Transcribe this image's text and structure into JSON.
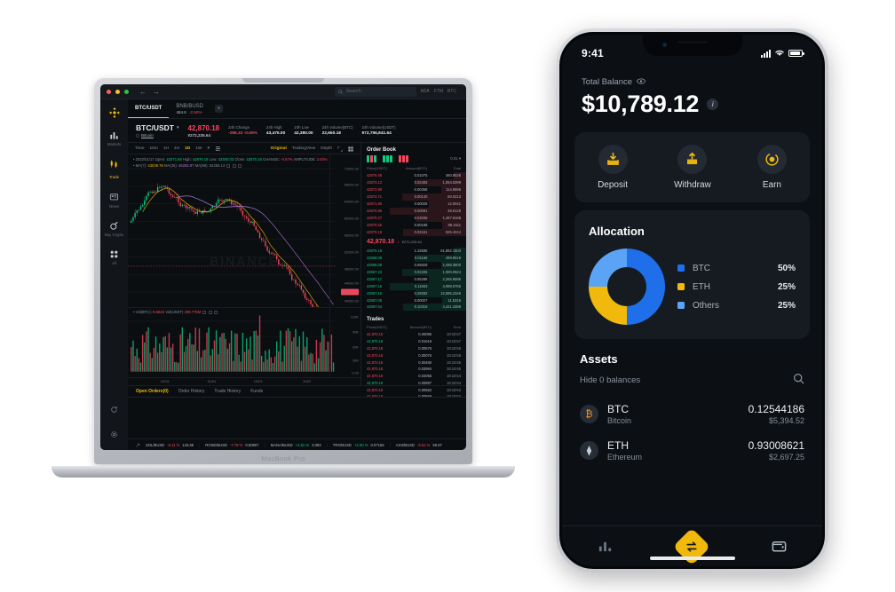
{
  "laptop": {
    "model_label": "MacBook Pro",
    "titlebar": {
      "back_icon": "arrow-left-icon",
      "forward_icon": "arrow-right-icon",
      "search_placeholder": "Search",
      "tags": [
        "ADA",
        "FTM",
        "BTC"
      ]
    },
    "sidebar": {
      "logo": "binance-logo-icon",
      "items": [
        {
          "label": "Markets",
          "icon": "bar-chart-icon",
          "active": false
        },
        {
          "label": "Trade",
          "icon": "candles-icon",
          "active": true
        },
        {
          "label": "News",
          "icon": "news-icon",
          "active": false
        },
        {
          "label": "Buy Crypto",
          "icon": "coin-icon",
          "active": false
        },
        {
          "label": "All",
          "icon": "grid-icon",
          "active": false
        }
      ],
      "bottom": [
        {
          "label": "refresh-icon"
        },
        {
          "label": "settings-icon"
        }
      ]
    },
    "pair_tabs": [
      {
        "label": "BTC/USDT",
        "active": true,
        "price": "",
        "change": ""
      },
      {
        "label": "BNB/BUSD",
        "active": false,
        "price": "484.6",
        "change": "-2.50%"
      }
    ],
    "add_tab_label": "+",
    "ticker": {
      "pair": "BTC/USDT",
      "chevron": "▾",
      "sub_link": "Bitcoin",
      "last_price": "42,870.18",
      "last_price_fiat": "¥272,235.64",
      "stats": [
        {
          "key": "24h Change",
          "value": "-286.32 -0.65%",
          "down": true
        },
        {
          "key": "24h High",
          "value": "43,475.00",
          "down": false
        },
        {
          "key": "24h Low",
          "value": "42,380.00",
          "down": false
        },
        {
          "key": "24h Volume(BTC)",
          "value": "22,650.18",
          "down": false
        },
        {
          "key": "24h Volume(USDT)",
          "value": "972,756,841.64",
          "down": false
        }
      ]
    },
    "timeframes": {
      "label": "Time",
      "items": [
        {
          "label": "15m",
          "active": false
        },
        {
          "label": "1H",
          "active": false
        },
        {
          "label": "4H",
          "active": false
        },
        {
          "label": "1D",
          "active": true
        },
        {
          "label": "1W",
          "active": false
        }
      ],
      "chevron": "▾",
      "settings_icon": "chart-settings-icon",
      "views": [
        {
          "label": "Original",
          "active": true
        },
        {
          "label": "TradingView",
          "active": false
        },
        {
          "label": "Depth",
          "active": false
        }
      ],
      "expand_icon": "expand-icon",
      "layout_icon": "layout-grid-icon"
    },
    "chart": {
      "watermark": "BINANCE",
      "ohlc_line": {
        "date": "2022/01/17",
        "open_label": "Open:",
        "open": "42071.66",
        "high_label": "High:",
        "high": "42876.18",
        "low_label": "Low:",
        "low": "42300.03",
        "close_label": "Close:",
        "close": "42870.18",
        "change_label": "CHANGE:",
        "change": "-0.67%",
        "amp_label": "AMPLITUDE:",
        "amplitude": "2.83%"
      },
      "ma_line": {
        "ma7_label": "MA(7):",
        "ma7": "43039.76",
        "ma25_label": "MA(25):",
        "ma25": "46282.97",
        "ma99_label": "MA(99):",
        "ma99": "54256.13"
      },
      "volume_line": {
        "vol_btc_label": "Vol(BTC):",
        "vol_btc": "9.584K",
        "vol_usdt_label": "Vol(USDT)",
        "vol_usdt": "408.776M"
      },
      "y_ticks": [
        "72000.00",
        "68000.00",
        "64000.00",
        "60000.00",
        "56000.00",
        "52000.00",
        "48000.00",
        "44000.00",
        "40000.00"
      ],
      "y_marker": "42870.18",
      "vol_y_ticks": [
        "120K",
        "90K",
        "60K",
        "30K",
        "0.00"
      ],
      "x_ticks": [
        "10/01",
        "11/01",
        "12/01",
        "2022"
      ]
    },
    "orderbook": {
      "title": "Order Book",
      "precision": "0.01",
      "headers": [
        "Price(USDT)",
        "Amount(BTC)",
        "Total"
      ],
      "asks": [
        {
          "price": "42876.48",
          "amount": "0.01075",
          "total": "460.9528"
        },
        {
          "price": "42873.13",
          "amount": "0.02483",
          "total": "1,064.5399"
        },
        {
          "price": "42872.99",
          "amount": "0.00358",
          "total": "114.8996"
        },
        {
          "price": "42872.71",
          "amount": "0.00140",
          "total": "60.0213"
        },
        {
          "price": "42871.86",
          "amount": "0.00028",
          "total": "12.0041"
        },
        {
          "price": "42870.96",
          "amount": "0.00091",
          "total": "39.0125"
        },
        {
          "price": "42870.27",
          "amount": "0.03036",
          "total": "1,287.9188"
        },
        {
          "price": "42870.26",
          "amount": "0.00188",
          "total": "89.1611"
        },
        {
          "price": "42870.19",
          "amount": "0.02161",
          "total": "926.4244"
        }
      ],
      "mid_price": "42,870.18",
      "mid_arrow": "↓",
      "mid_fiat": "¥272,235.64",
      "bids": [
        {
          "price": "42870.18",
          "amount": "1.42585",
          "total": "61,892.1503"
        },
        {
          "price": "42868.09",
          "amount": "0.01166",
          "total": "499.8619"
        },
        {
          "price": "42868.08",
          "amount": "0.05829",
          "total": "2,498.3800"
        },
        {
          "price": "42867.23",
          "amount": "0.02335",
          "total": "1,000.0924"
        },
        {
          "price": "42867.17",
          "amount": "0.05286",
          "total": "2,265.9586"
        },
        {
          "price": "42867.16",
          "amount": "0.11663",
          "total": "4,999.5765"
        },
        {
          "price": "42867.15",
          "amount": "0.29282",
          "total": "12,595.2346"
        },
        {
          "price": "42867.05",
          "amount": "0.00027",
          "total": "11.5316"
        },
        {
          "price": "42867.04",
          "amount": "0.10316",
          "total": "4,421.3388"
        }
      ]
    },
    "trades": {
      "title": "Trades",
      "headers": [
        "Price(USDT)",
        "Amount(BTC)",
        "Time"
      ],
      "rows": [
        {
          "price": "42,870.18",
          "amount": "0.00095",
          "time": "18:10:57",
          "up": false
        },
        {
          "price": "42,870.19",
          "amount": "0.01619",
          "time": "18:10:57",
          "up": true
        },
        {
          "price": "42,870.18",
          "amount": "0.00676",
          "time": "18:10:56",
          "up": false
        },
        {
          "price": "42,870.18",
          "amount": "0.00076",
          "time": "18:10:56",
          "up": false
        },
        {
          "price": "42,870.18",
          "amount": "0.00480",
          "time": "18:10:55",
          "up": false
        },
        {
          "price": "42,870.18",
          "amount": "0.03994",
          "time": "18:10:55",
          "up": false
        },
        {
          "price": "42,870.18",
          "amount": "0.04055",
          "time": "18:10:54",
          "up": false
        },
        {
          "price": "42,870.19",
          "amount": "0.00897",
          "time": "18:10:54",
          "up": true
        },
        {
          "price": "42,870.18",
          "amount": "0.00562",
          "time": "18:10:53",
          "up": false
        },
        {
          "price": "42,870.18",
          "amount": "0.00569",
          "time": "18:10:52",
          "up": false
        }
      ]
    },
    "order_tabs": [
      {
        "label": "Open Orders(0)",
        "active": true
      },
      {
        "label": "Order History",
        "active": false
      },
      {
        "label": "Trade History",
        "active": false
      },
      {
        "label": "Funds",
        "active": false
      }
    ],
    "bottom_ticker": [
      {
        "symbol": "SOL/BUSD",
        "change": "-6.11 %",
        "price": "143.66",
        "down": true
      },
      {
        "symbol": "ROSE/BUSD",
        "change": "-7.79 %",
        "price": "0.50807",
        "down": true
      },
      {
        "symbol": "MANA/BUSD",
        "change": "+2.51 %",
        "price": "3.083",
        "down": false
      },
      {
        "symbol": "TRX/BUSD",
        "change": "+2.00 %",
        "price": "0.07156",
        "down": false
      },
      {
        "symbol": "AXS/BUSD",
        "change": "-6.51 %",
        "price": "59.67",
        "down": true
      }
    ]
  },
  "phone": {
    "status": {
      "time": "9:41",
      "signal_icon": "cellular-bars-icon",
      "wifi_icon": "wifi-icon",
      "battery_icon": "battery-icon"
    },
    "balance": {
      "label": "Total Balance",
      "eye_icon": "eye-icon",
      "amount": "$10,789.12",
      "info_icon": "info-icon",
      "info_glyph": "i"
    },
    "actions": [
      {
        "label": "Deposit",
        "icon": "deposit-icon"
      },
      {
        "label": "Withdraw",
        "icon": "withdraw-icon"
      },
      {
        "label": "Earn",
        "icon": "earn-icon"
      }
    ],
    "allocation": {
      "title": "Allocation"
    },
    "assets": {
      "title": "Assets",
      "hide_label": "Hide 0 balances",
      "search_icon": "search-icon",
      "rows": [
        {
          "symbol": "BTC",
          "name": "Bitcoin",
          "glyph": "₿",
          "color": "#f7931a",
          "qty": "0.12544186",
          "usd": "$5,394.52"
        },
        {
          "symbol": "ETH",
          "name": "Ethereum",
          "glyph": "⧫",
          "color": "#c9cdd4",
          "qty": "0.93008621",
          "usd": "$2,697.25"
        }
      ]
    },
    "tabbar": [
      {
        "icon": "chart-icon",
        "active": false
      },
      {
        "icon": "swap-icon",
        "active": true
      },
      {
        "icon": "wallet-icon",
        "active": false
      }
    ]
  },
  "chart_data": {
    "type": "pie",
    "title": "Allocation",
    "labels": [
      "BTC",
      "ETH",
      "Others"
    ],
    "values": [
      50,
      25,
      25
    ],
    "display_values": [
      "50%",
      "25%",
      "25%"
    ],
    "colors": [
      "#1f6feb",
      "#f0b90b",
      "#5ba4f5"
    ],
    "legend_position": "right",
    "donut": true
  }
}
